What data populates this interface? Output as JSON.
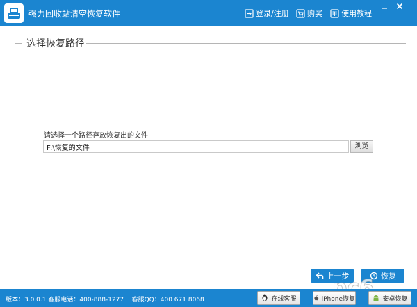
{
  "titlebar": {
    "title": "强力回收站清空恢复软件",
    "login_label": "登录/注册",
    "buy_label": "购买",
    "guide_label": "使用教程",
    "accent": "#1b85d0"
  },
  "section": {
    "title": "选择恢复路径"
  },
  "path": {
    "label": "请选择一个路径存放恢复出的文件",
    "value": "F:\\恢复的文件",
    "browse_label": "浏览"
  },
  "nav": {
    "prev_label": "上一步",
    "next_label": "恢复"
  },
  "statusbar": {
    "version": "版本：3.0.0.1",
    "phone": "客服电话：400-888-1277",
    "qq": "客服QQ：400 671 8068",
    "online_label": "在线客服",
    "iphone_label": "iPhone恢复",
    "android_label": "安卓恢复"
  }
}
